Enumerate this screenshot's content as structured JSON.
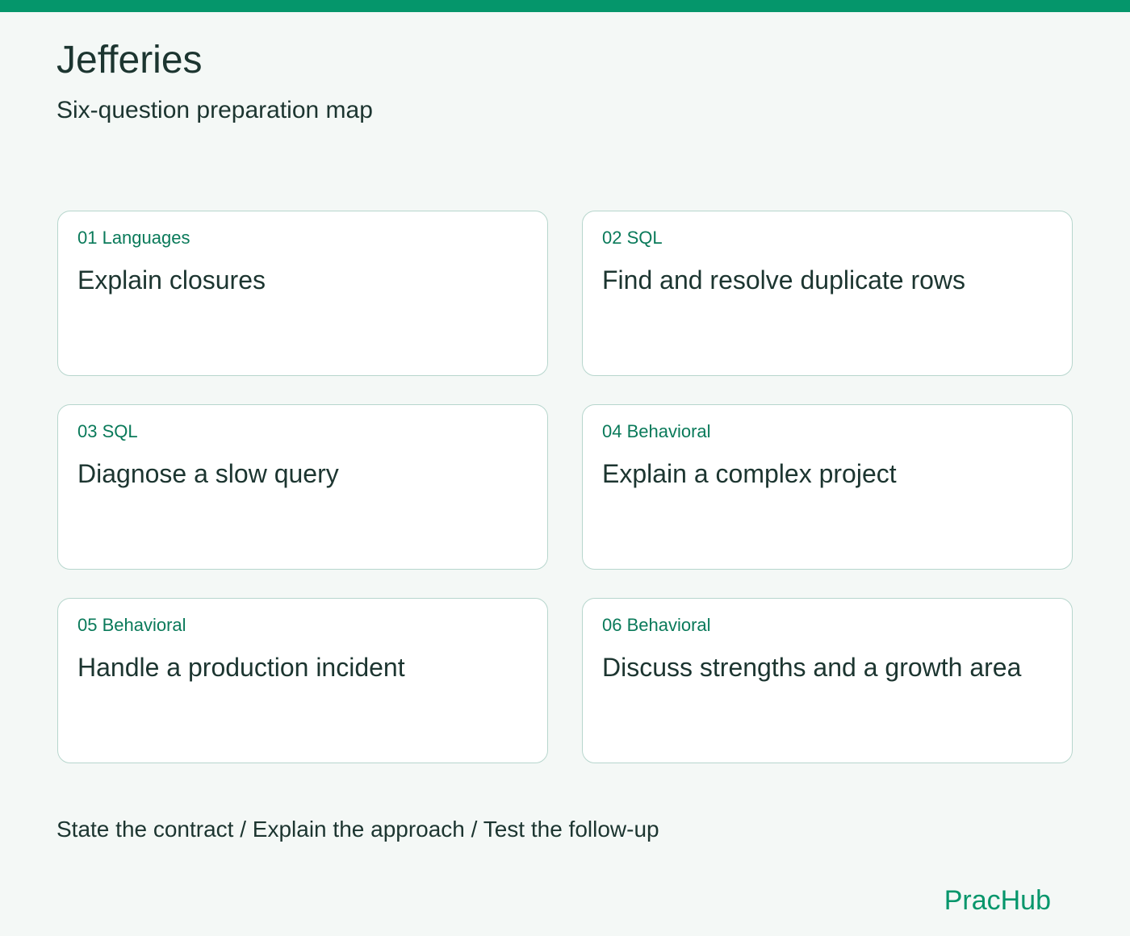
{
  "header": {
    "title": "Jefferies",
    "subtitle": "Six-question preparation map"
  },
  "cards": [
    {
      "tag": "01 Languages",
      "title": "Explain closures"
    },
    {
      "tag": "02 SQL",
      "title": "Find and resolve duplicate rows"
    },
    {
      "tag": "03 SQL",
      "title": "Diagnose a slow query"
    },
    {
      "tag": "04 Behavioral",
      "title": "Explain a complex project"
    },
    {
      "tag": "05 Behavioral",
      "title": "Handle a production incident"
    },
    {
      "tag": "06 Behavioral",
      "title": "Discuss strengths and a growth area"
    }
  ],
  "footer": {
    "steps": "State the contract / Explain the approach / Test the follow-up",
    "brand": "PracHub"
  },
  "colors": {
    "accent": "#05966b",
    "tag_text": "#0a7a5a",
    "card_border": "#b7d6cd",
    "background": "#f4f8f6"
  }
}
